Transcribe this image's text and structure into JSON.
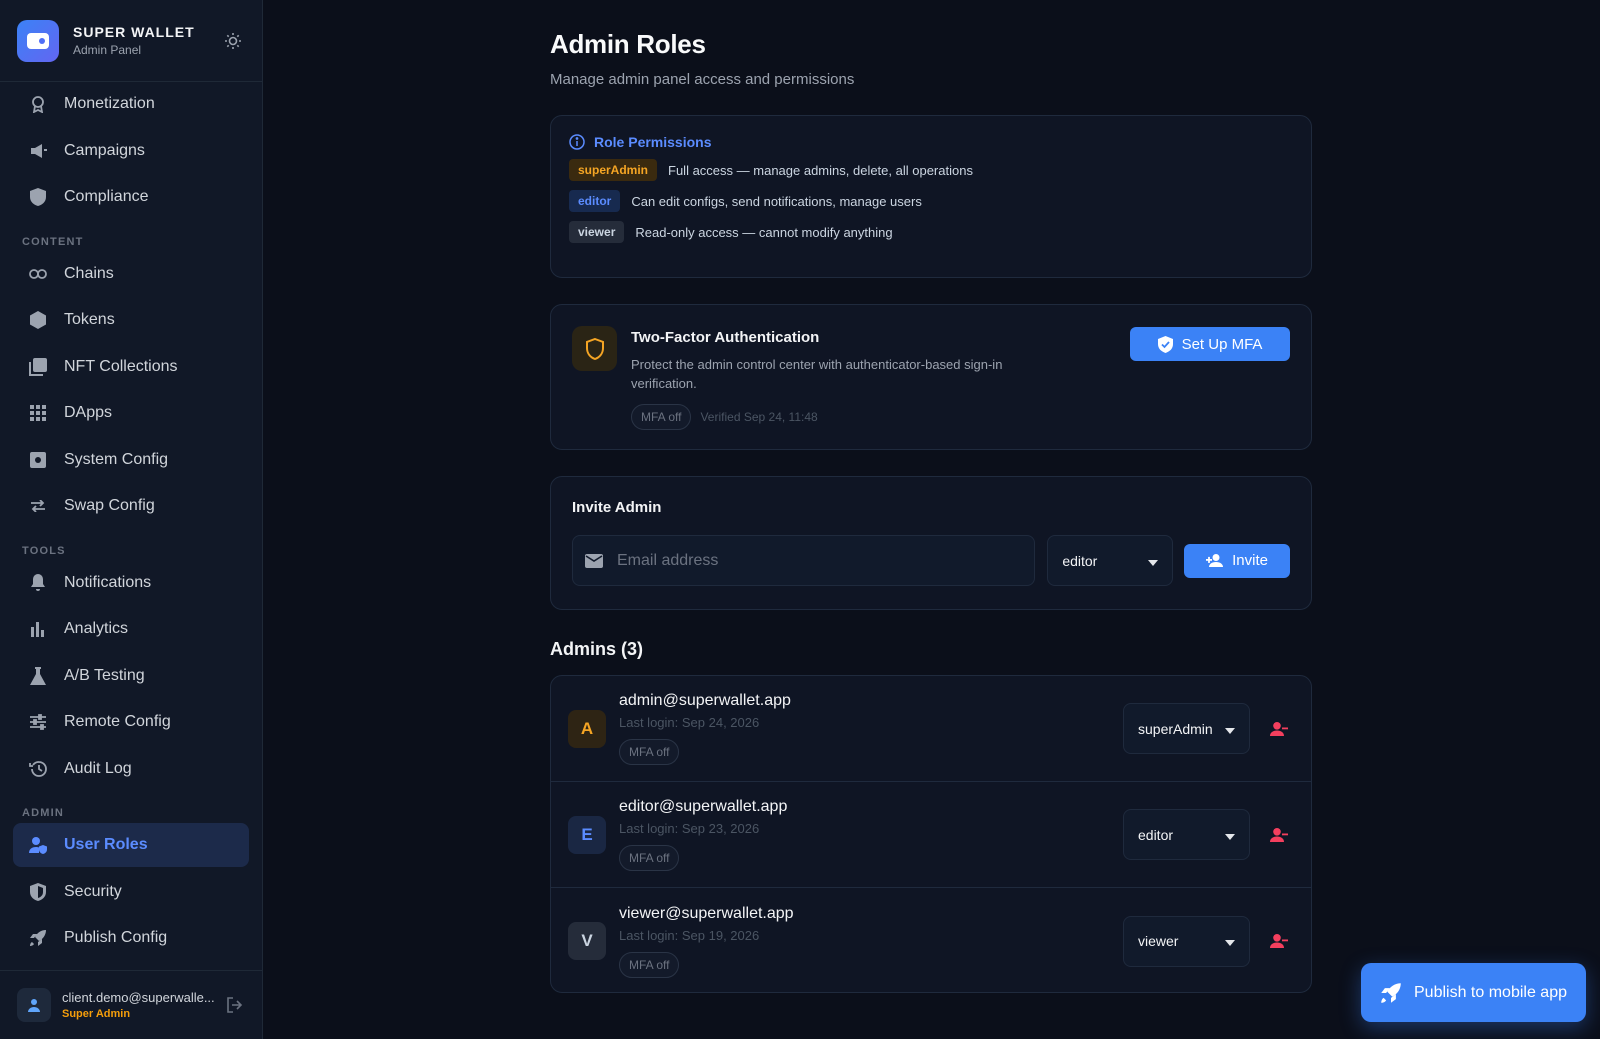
{
  "brand": {
    "title": "SUPER WALLET",
    "subtitle": "Admin Panel"
  },
  "sidebar": {
    "top_items": [
      {
        "label": "Monetization",
        "icon": "badge-icon"
      },
      {
        "label": "Campaigns",
        "icon": "megaphone-icon"
      },
      {
        "label": "Compliance",
        "icon": "shield-icon"
      }
    ],
    "sections": {
      "content": "CONTENT",
      "tools": "TOOLS",
      "admin": "ADMIN"
    },
    "content_items": [
      {
        "label": "Chains",
        "icon": "link-icon"
      },
      {
        "label": "Tokens",
        "icon": "token-icon"
      },
      {
        "label": "NFT Collections",
        "icon": "gallery-icon"
      },
      {
        "label": "DApps",
        "icon": "grid-icon"
      },
      {
        "label": "System Config",
        "icon": "settings-box-icon"
      },
      {
        "label": "Swap Config",
        "icon": "swap-icon"
      }
    ],
    "tools_items": [
      {
        "label": "Notifications",
        "icon": "bell-icon"
      },
      {
        "label": "Analytics",
        "icon": "bar-chart-icon"
      },
      {
        "label": "A/B Testing",
        "icon": "flask-icon"
      },
      {
        "label": "Remote Config",
        "icon": "sliders-icon"
      },
      {
        "label": "Audit Log",
        "icon": "history-icon"
      }
    ],
    "admin_items": [
      {
        "label": "User Roles",
        "icon": "user-shield-icon",
        "active": true
      },
      {
        "label": "Security",
        "icon": "shield-lock-icon"
      },
      {
        "label": "Publish Config",
        "icon": "rocket-icon"
      }
    ],
    "user": {
      "email": "client.demo@superwalle...",
      "role": "Super Admin"
    }
  },
  "page": {
    "title": "Admin Roles",
    "subtitle": "Manage admin panel access and permissions"
  },
  "permissions": {
    "heading": "Role Permissions",
    "rows": [
      {
        "role": "superAdmin",
        "desc": "Full access — manage admins, delete, all operations"
      },
      {
        "role": "editor",
        "desc": "Can edit configs, send notifications, manage users"
      },
      {
        "role": "viewer",
        "desc": "Read-only access — cannot modify anything"
      }
    ]
  },
  "mfa": {
    "title": "Two-Factor Authentication",
    "description": "Protect the admin control center with authenticator-based sign-in verification.",
    "status": "MFA off",
    "verified": "Verified Sep 24, 11:48",
    "button": "Set Up MFA"
  },
  "invite": {
    "title": "Invite Admin",
    "placeholder": "Email address",
    "value": "",
    "role": "editor",
    "button": "Invite"
  },
  "admins": {
    "title": "Admins (3)",
    "list": [
      {
        "initial": "A",
        "email": "admin@superwallet.app",
        "last_login": "Last login: Sep 24, 2026",
        "mfa": "MFA off",
        "role": "superAdmin"
      },
      {
        "initial": "E",
        "email": "editor@superwallet.app",
        "last_login": "Last login: Sep 23, 2026",
        "mfa": "MFA off",
        "role": "editor"
      },
      {
        "initial": "V",
        "email": "viewer@superwallet.app",
        "last_login": "Last login: Sep 19, 2026",
        "mfa": "MFA off",
        "role": "viewer"
      }
    ]
  },
  "publish": {
    "label": "Publish to mobile app"
  },
  "colors": {
    "accent": "#3b82f6",
    "active_text": "#5b8cff",
    "super_admin": "#f5a524",
    "danger": "#f43f5e",
    "background": "#0b0f1a",
    "sidebar": "#111827"
  }
}
